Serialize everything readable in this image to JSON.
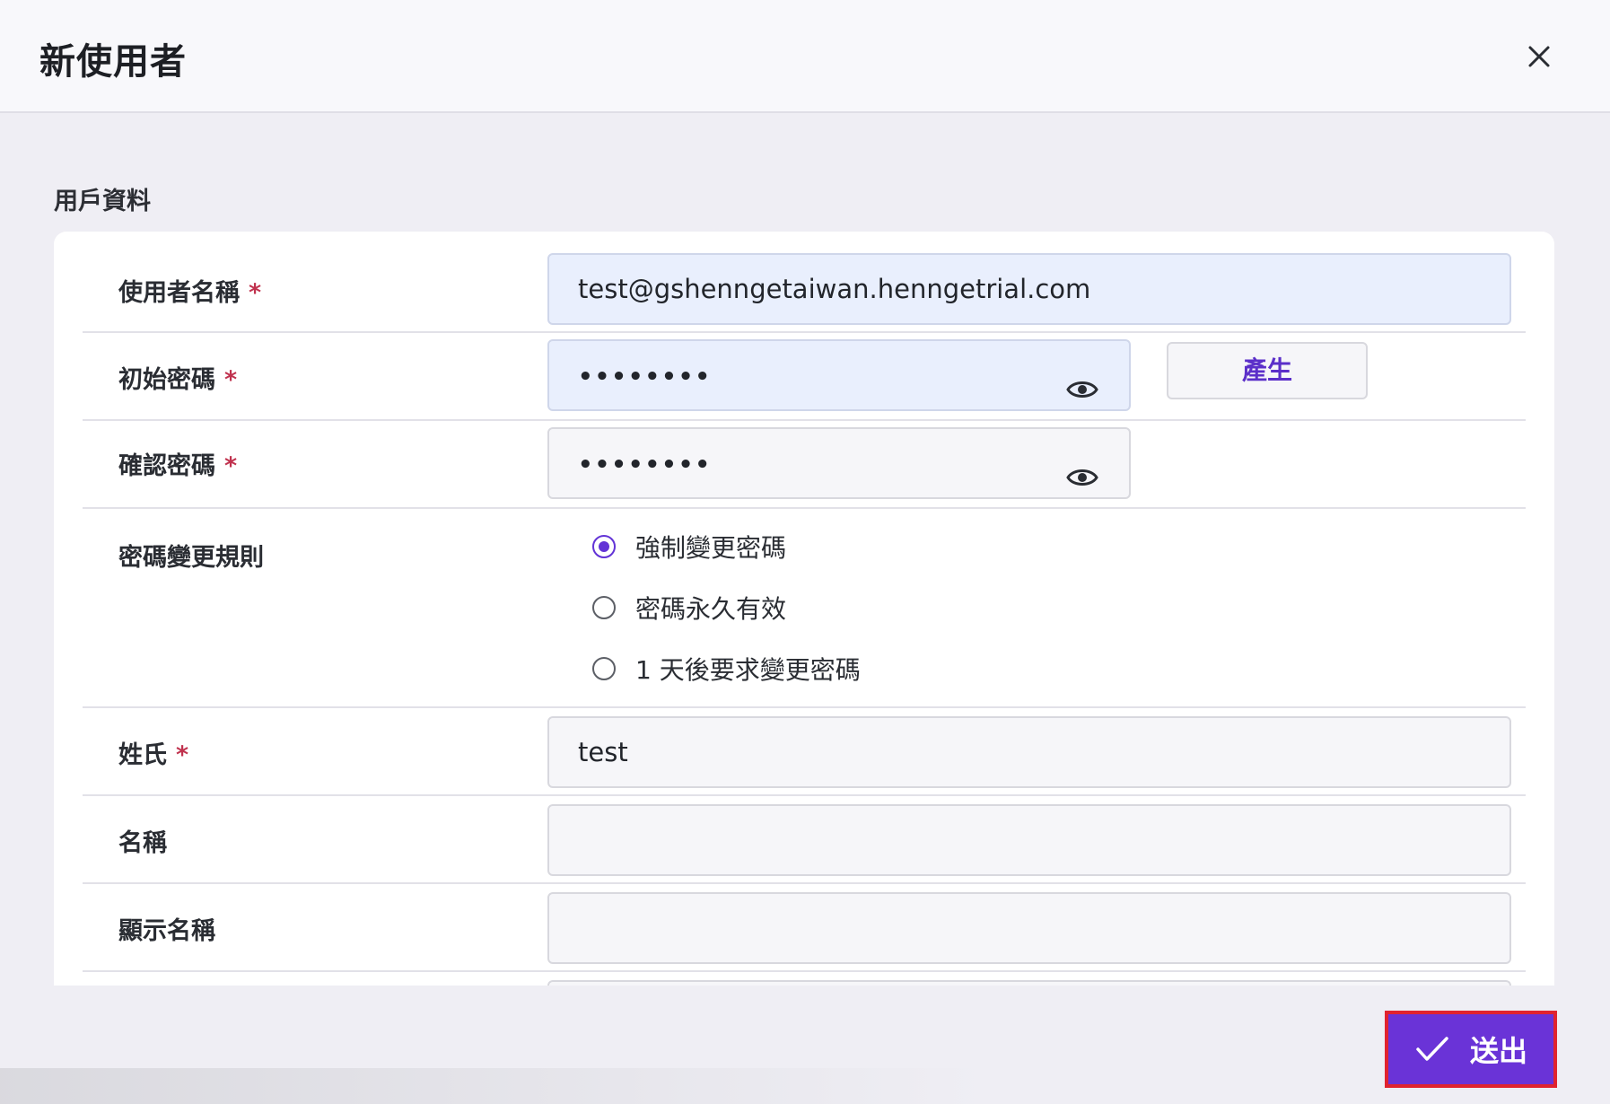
{
  "dialog": {
    "title": "新使用者",
    "close_icon": "close-icon"
  },
  "section": {
    "title": "用戶資料"
  },
  "required_mark": "*",
  "fields": {
    "username": {
      "label": "使用者名稱",
      "value": "test@gshenngetaiwan.henngetrial.com"
    },
    "initial_password": {
      "label": "初始密碼",
      "value": "••••••••",
      "generate_label": "產生"
    },
    "confirm_password": {
      "label": "確認密碼",
      "value": "••••••••"
    },
    "password_rule": {
      "label": "密碼變更規則",
      "options": [
        {
          "label": "強制變更密碼",
          "checked": true
        },
        {
          "label": "密碼永久有效",
          "checked": false
        },
        {
          "label": "1 天後要求變更密碼",
          "checked": false
        }
      ]
    },
    "last_name": {
      "label": "姓氏",
      "value": "test"
    },
    "first_name": {
      "label": "名稱",
      "value": ""
    },
    "display_name": {
      "label": "顯示名稱",
      "value": ""
    }
  },
  "footer": {
    "submit_label": "送出"
  },
  "colors": {
    "accent": "#6a33d7",
    "required": "#c0324e",
    "highlight_border": "#e0232f"
  }
}
